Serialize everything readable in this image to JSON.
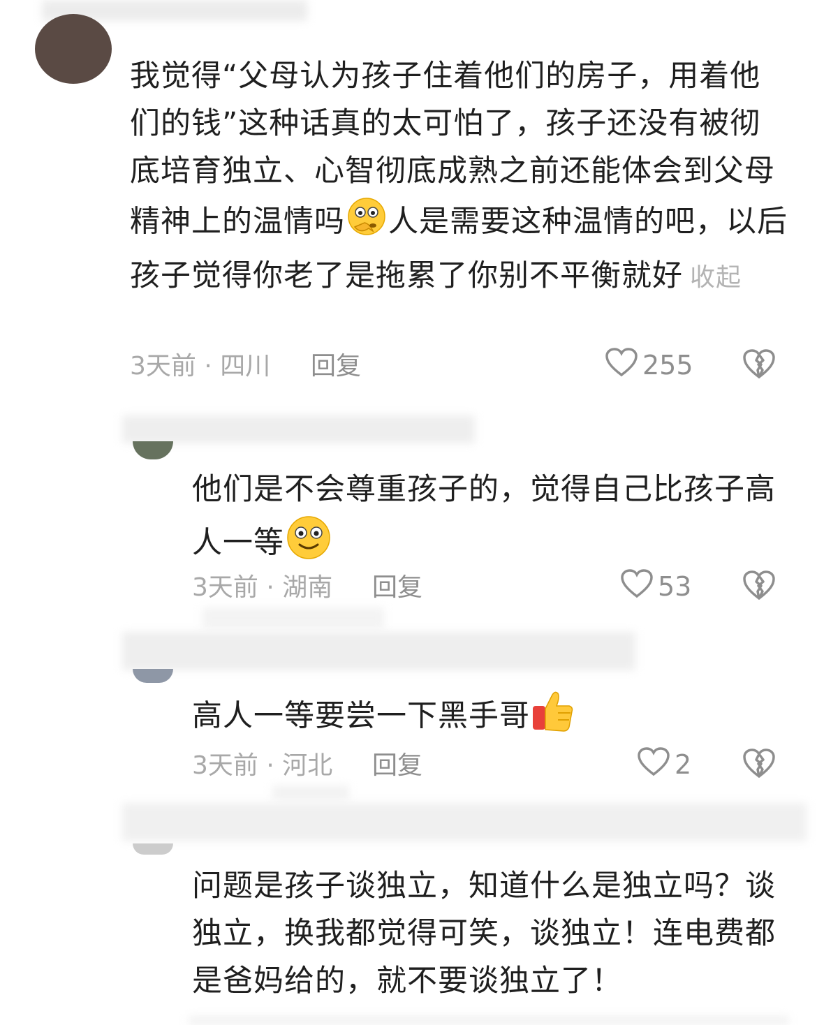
{
  "comments": [
    {
      "text": "我觉得“父母认为孩子住着他们的房子，用着他们的钱”这种话真的太可怕了，孩子还没有被彻底培育独立、心智彻底成熟之前还能体会到父母精神上的温情吗",
      "text_after": "人是需要这种温情的吧，以后孩子觉得你老了是拖累了你别不平衡就好",
      "emoji": "thinking-face-emoji",
      "collapse_label": "收起",
      "meta": "3天前 · 四川",
      "reply_label": "回复",
      "likes": "255"
    },
    {
      "text": "他们是不会尊重孩子的，觉得自己比孩子高人一等",
      "emoji": "smiling-face-emoji",
      "meta": "3天前 · 湖南",
      "reply_label": "回复",
      "likes": "53"
    },
    {
      "text": "高人一等要尝一下黑手哥",
      "emoji": "thumbs-up-emoji",
      "meta": "3天前 · 河北",
      "reply_label": "回复",
      "likes": "2"
    },
    {
      "text": "问题是孩子谈独立，知道什么是独立吗？谈独立，换我都觉得可笑，谈独立！连电费都是爸妈给的，就不要谈独立了！"
    }
  ],
  "colors": {
    "text": "#1f1f1f",
    "meta": "#a8a8a8",
    "icon": "#8e8e8e"
  }
}
